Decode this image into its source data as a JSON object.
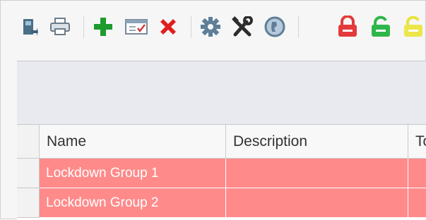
{
  "toolbar": {
    "icons": [
      "export-icon",
      "print-icon",
      "add-icon",
      "calendar-check-icon",
      "delete-icon",
      "settings-gear-icon",
      "tools-icon",
      "globe-icon",
      "lock-red-icon",
      "lock-green-icon",
      "lock-yellow-icon"
    ]
  },
  "grid": {
    "columns": [
      "Name",
      "Description",
      "To"
    ],
    "rows": [
      {
        "name": "Lockdown Group 1",
        "description": "",
        "to": ""
      },
      {
        "name": "Lockdown Group 2",
        "description": "",
        "to": ""
      }
    ],
    "row_color": "#ff8a8a"
  }
}
